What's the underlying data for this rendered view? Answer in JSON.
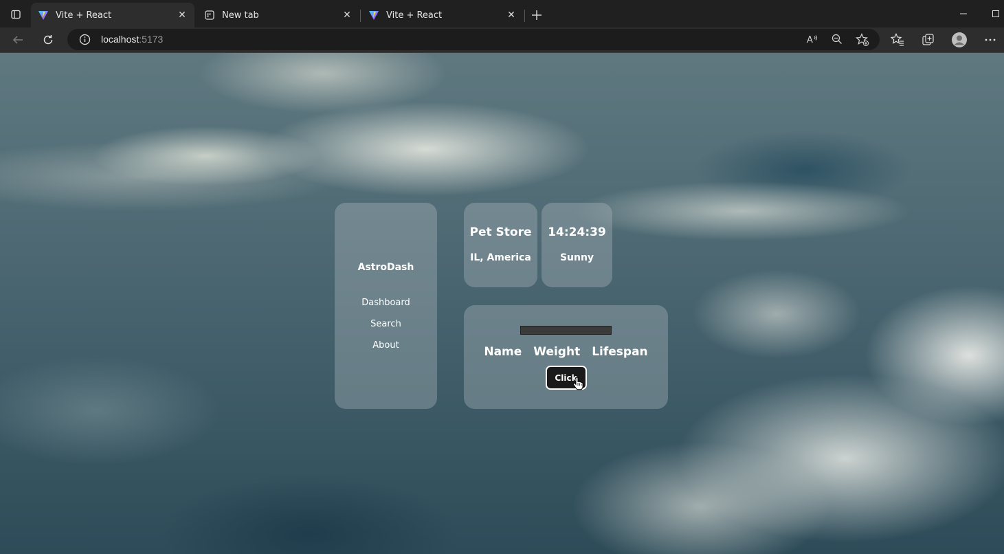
{
  "browser": {
    "tabs": [
      {
        "title": "Vite + React",
        "active": true,
        "favicon": "vite-icon"
      },
      {
        "title": "New tab",
        "active": false,
        "favicon": "newtab-icon"
      },
      {
        "title": "Vite + React",
        "active": false,
        "favicon": "vite-icon"
      }
    ],
    "address": {
      "host": "localhost",
      "port": ":5173"
    }
  },
  "sidebar": {
    "brand": "AstroDash",
    "links": [
      "Dashboard",
      "Search",
      "About"
    ]
  },
  "store_card": {
    "name": "Pet Store",
    "location": "IL, America"
  },
  "time_card": {
    "time": "14:24:39",
    "weather": "Sunny"
  },
  "pet_card": {
    "headers": [
      "Name",
      "Weight",
      "Lifespan"
    ],
    "button_label": "Click"
  },
  "colors": {
    "card_bg": "rgba(170,182,186,0.38)",
    "button_bg": "#1a1a1a",
    "chrome_bg": "#202020"
  }
}
